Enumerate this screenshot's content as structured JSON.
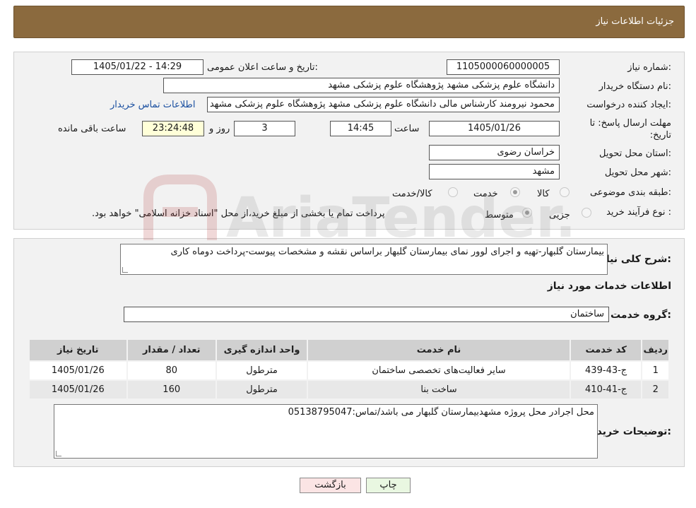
{
  "header": {
    "title": "جزئیات اطلاعات نیاز"
  },
  "need_number": {
    "label": "شماره نیاز:",
    "value": "1105000060000005"
  },
  "announce_datetime": {
    "label": "تاریخ و ساعت اعلان عمومی:",
    "value": "1405/01/22 - 14:29"
  },
  "buyer_org": {
    "label": "نام دستگاه خریدار:",
    "value": "دانشگاه علوم پزشکی مشهد   پژوهشگاه علوم پزشکی مشهد"
  },
  "requester": {
    "label": "ایجاد کننده درخواست:",
    "value": "محمود نیرومند کارشناس مالی دانشگاه علوم پزشکی مشهد   پژوهشگاه علوم پزشکی مشهد",
    "contact_link": "اطلاعات تماس خریدار"
  },
  "deadline": {
    "label": "مهلت ارسال پاسخ: تا تاریخ:",
    "date": "1405/01/26",
    "time_label": "ساعت",
    "time": "14:45",
    "days": "3",
    "days_label": "روز و",
    "remaining": "23:24:48",
    "remaining_label": "ساعت باقی مانده"
  },
  "province": {
    "label": "استان محل تحویل:",
    "value": "خراسان رضوی"
  },
  "city": {
    "label": "شهر محل تحویل:",
    "value": "مشهد"
  },
  "category": {
    "label": "طبقه بندی موضوعی:",
    "options": [
      "کالا",
      "خدمت",
      "کالا/خدمت"
    ],
    "selected": "خدمت"
  },
  "purchase_type": {
    "label": "نوع فرآیند خرید :",
    "options": [
      "جزیی",
      "متوسط"
    ],
    "selected": "متوسط",
    "note": "پرداخت تمام یا بخشی از مبلغ خرید،از محل \"اسناد خزانه اسلامی\" خواهد بود."
  },
  "description": {
    "label": "شرح کلی نیاز:",
    "value": "بیمارستان گلبهار-تهیه و اجرای لوور نمای بیمارستان گلبهار  براساس نقشه و مشخصات پیوست-پرداخت دوماه کاری"
  },
  "services_section": {
    "title": "اطلاعات خدمات مورد نیاز"
  },
  "service_group": {
    "label": "گروه خدمت:",
    "value": "ساختمان"
  },
  "table": {
    "headers": [
      "ردیف",
      "کد خدمت",
      "نام خدمت",
      "واحد اندازه گیری",
      "تعداد / مقدار",
      "تاریخ نیاز"
    ],
    "rows": [
      [
        "1",
        "ج-43-439",
        "سایر فعالیت‌های تخصصی ساختمان",
        "مترطول",
        "80",
        "1405/01/26"
      ],
      [
        "2",
        "ج-41-410",
        "ساخت بنا",
        "مترطول",
        "160",
        "1405/01/26"
      ]
    ]
  },
  "buyer_notes": {
    "label": "توضیحات خریدار:",
    "value": "محل اجرادر محل پروژه  مشهدبیمارستان گلبهار می باشد/تماس:05138795047"
  },
  "buttons": {
    "print": "چاپ",
    "back": "بازگشت"
  },
  "watermark": {
    "text": "AriaTender.neT"
  }
}
